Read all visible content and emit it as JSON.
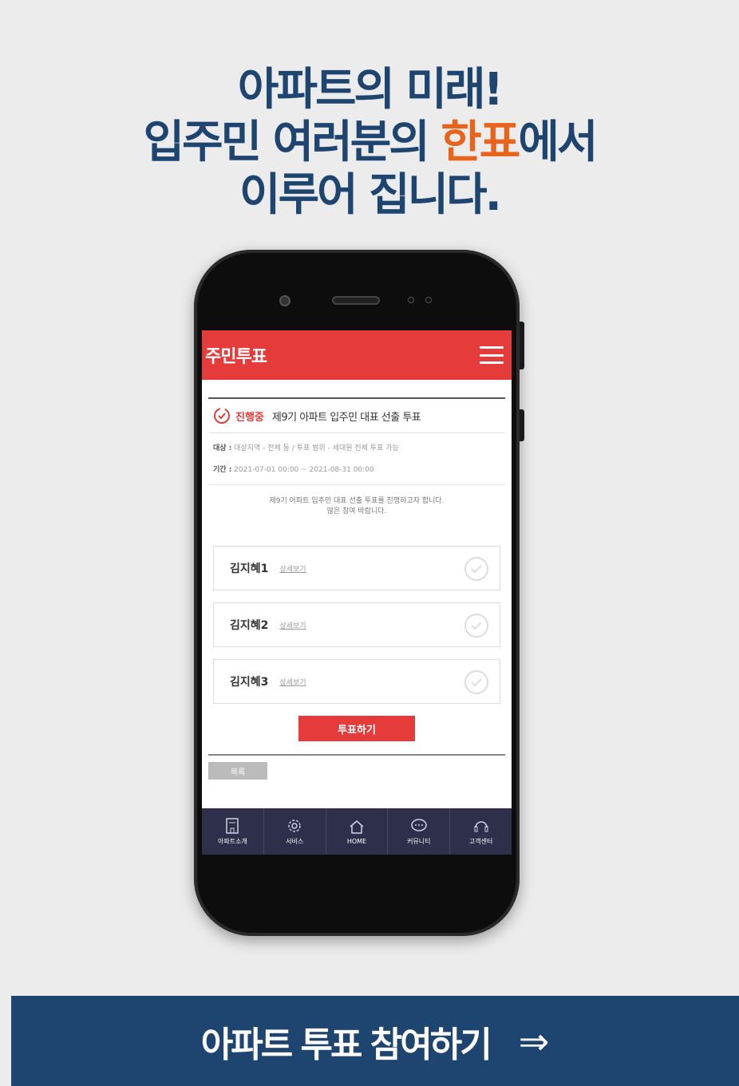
{
  "headline": {
    "line1": "아파트의 미래!",
    "line2_pre": "입주민 여러분의 ",
    "line2_accent": "한표",
    "line2_post": "에서",
    "line3": "이루어 집니다."
  },
  "app": {
    "title": "주민투표",
    "vote": {
      "status": "진행중",
      "title": "제9기 아파트 입주민 대표 선출 투표",
      "target_label": "대상 :",
      "target_text": "대상지역 - 전체 동 / 투표 범위 - 세대원 전체 투표 가능",
      "period_label": "기간 :",
      "period_text": "2021-07-01 00:00 ~ 2021-08-31 00:00",
      "notice_line1": "제9기 아파트 입주민 대표 선출 투표를 진행하고자 합니다.",
      "notice_line2": "많은 참여 바랍니다."
    },
    "candidates": [
      {
        "name": "김지혜1",
        "detail": "상세보기"
      },
      {
        "name": "김지혜2",
        "detail": "상세보기"
      },
      {
        "name": "김지혜3",
        "detail": "상세보기"
      }
    ],
    "vote_button": "투표하기",
    "list_button": "목록",
    "tabs": [
      {
        "label": "아파트소개",
        "icon": "building-icon"
      },
      {
        "label": "서비스",
        "icon": "gear-icon"
      },
      {
        "label": "HOME",
        "icon": "home-icon"
      },
      {
        "label": "커뮤니티",
        "icon": "chat-icon"
      },
      {
        "label": "고객센터",
        "icon": "headset-icon"
      }
    ]
  },
  "footer": {
    "label": "아파트 투표 참여하기",
    "arrow": "⇒"
  },
  "colors": {
    "navy": "#1e4470",
    "accent_orange": "#e8641c",
    "app_red": "#e63b3b",
    "tabbar": "#2e2f4a"
  }
}
